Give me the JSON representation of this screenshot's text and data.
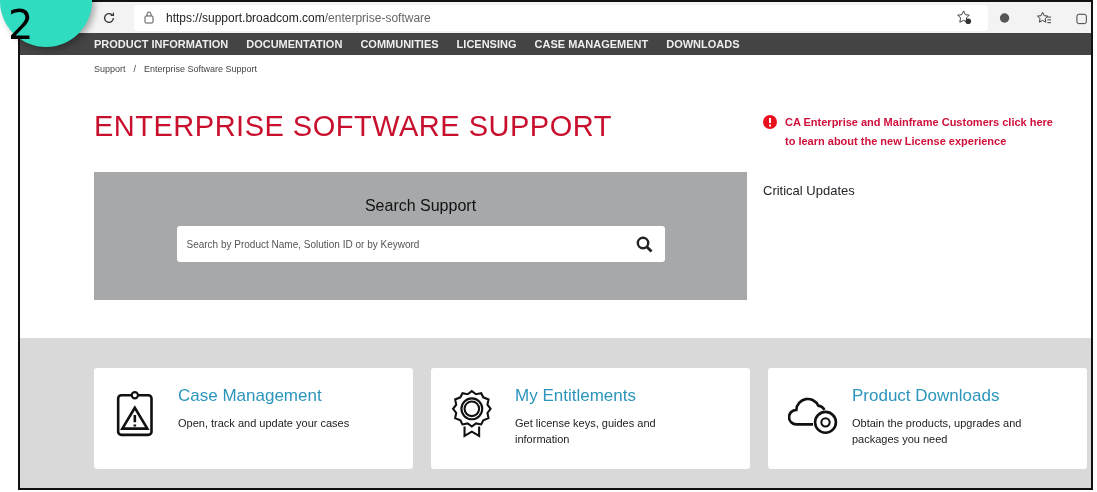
{
  "step_badge": "2",
  "browser": {
    "url_host": "https://support.broadcom.com",
    "url_path": "/enterprise-software"
  },
  "nav": [
    "PRODUCT INFORMATION",
    "DOCUMENTATION",
    "COMMUNITIES",
    "LICENSING",
    "CASE MANAGEMENT",
    "DOWNLOADS"
  ],
  "breadcrumb": [
    "Support",
    "Enterprise Software Support"
  ],
  "breadcrumb_separator": "/",
  "page_title": "ENTERPRISE SOFTWARE SUPPORT",
  "notice": {
    "line1": "CA Enterprise and Mainframe Customers click here",
    "line2": "to learn about the new License experience"
  },
  "search": {
    "heading": "Search Support",
    "placeholder": "Search by Product Name, Solution ID or by Keyword"
  },
  "critical_updates": "Critical Updates",
  "cards": [
    {
      "kind": "case",
      "title": "Case Management",
      "text": "Open, track and update your cases"
    },
    {
      "kind": "entitlement",
      "title": "My Entitlements",
      "text": "Get license keys, guides and information"
    },
    {
      "kind": "download",
      "title": "Product Downloads",
      "text": "Obtain the products, upgrades and packages you need"
    }
  ]
}
